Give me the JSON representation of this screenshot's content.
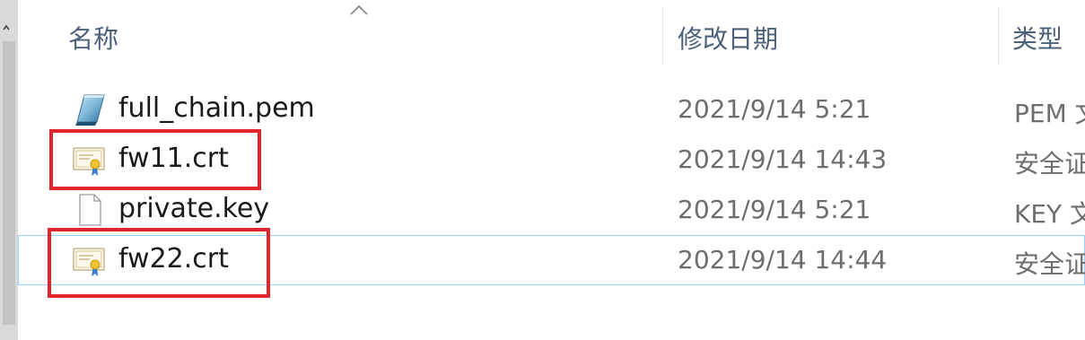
{
  "header": {
    "columns": [
      {
        "label": "名称"
      },
      {
        "label": "修改日期"
      },
      {
        "label": "类型"
      }
    ],
    "sort_icon": "chevron-up-icon"
  },
  "files": [
    {
      "name": "full_chain.pem",
      "date": "2021/9/14 5:21",
      "type": "PEM 文",
      "icon": "pem-file-icon"
    },
    {
      "name": "fw11.crt",
      "date": "2021/9/14 14:43",
      "type": "安全证",
      "icon": "certificate-icon"
    },
    {
      "name": "private.key",
      "date": "2021/9/14 5:21",
      "type": "KEY 文",
      "icon": "blank-file-icon"
    },
    {
      "name": "fw22.crt",
      "date": "2021/9/14 14:44",
      "type": "安全证",
      "icon": "certificate-icon"
    }
  ],
  "colors": {
    "highlight": "#e0262c",
    "hover_outline": "#99d1ff",
    "header_text": "#4c607a"
  }
}
